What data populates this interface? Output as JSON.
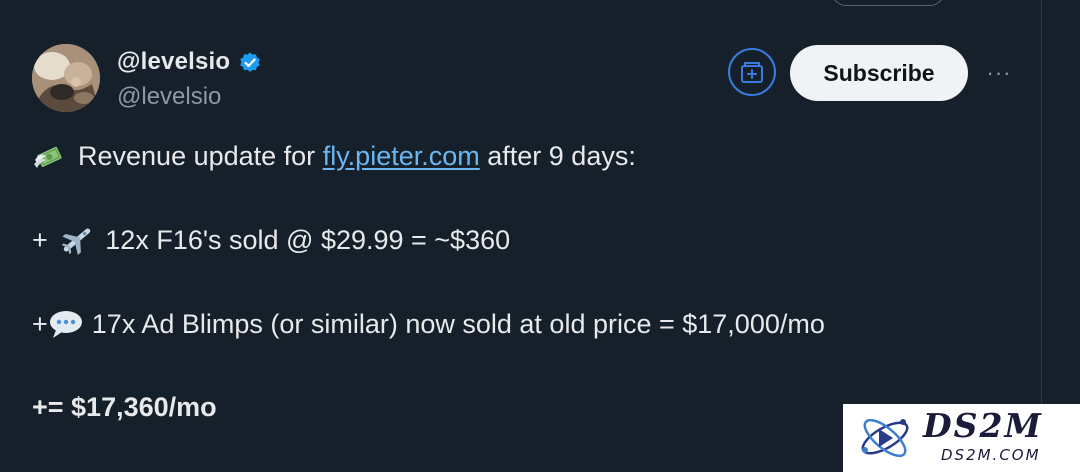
{
  "post": {
    "author": {
      "display_name": "@levelsio",
      "handle": "@levelsio",
      "verified": true,
      "verified_color": "#1d9bf0"
    },
    "actions": {
      "subscribe_label": "Subscribe",
      "more_label": "···"
    },
    "body": {
      "line1": {
        "emoji": "money-with-wings-icon",
        "prefix": "Revenue update for ",
        "link": "fly.pieter.com",
        "suffix": " after 9 days:"
      },
      "line2": {
        "prefix": "+ ",
        "emoji": "airplane-icon",
        "text": "12x F16's sold @ $29.99 = ~$360"
      },
      "line3": {
        "prefix": "+",
        "emoji": "speech-balloon-icon",
        "text": "17x Ad Blimps (or similar) now sold at old price = $17,000/mo"
      },
      "line4": {
        "text": "+= $17,360/mo"
      }
    }
  },
  "watermark": {
    "title": "DS2M",
    "subtitle": "DS2M.COM"
  },
  "colors": {
    "background": "#15202b",
    "text": "#e7e9ea",
    "muted": "#8b98a5",
    "link": "#6cb6f0",
    "accent": "#3a7be0"
  }
}
